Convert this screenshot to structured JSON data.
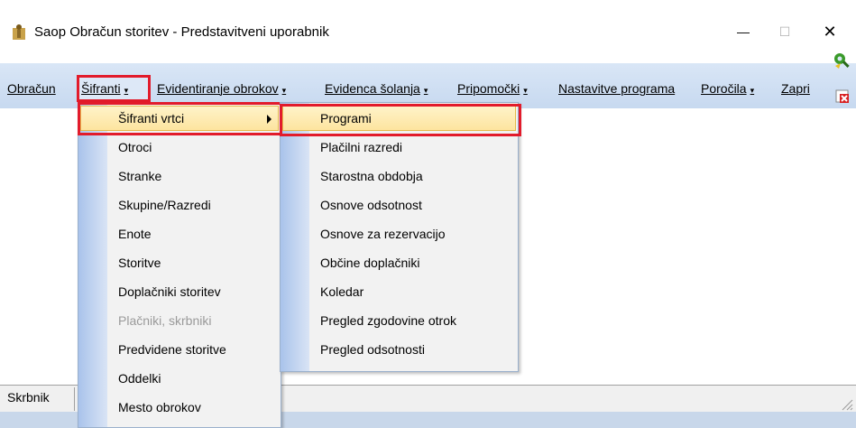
{
  "window": {
    "title": "Saop Obračun storitev - Predstavitveni uporabnik",
    "minimize_glyph": "—",
    "maximize_glyph": "☐",
    "close_glyph": "✕"
  },
  "menubar": [
    {
      "id": "obracun",
      "label": "Obračun",
      "has_arrow": false
    },
    {
      "id": "sifranti",
      "label": "Šifranti",
      "has_arrow": true
    },
    {
      "id": "evidentiranje",
      "label": "Evidentiranje obrokov",
      "has_arrow": true
    },
    {
      "id": "evidenca",
      "label": "Evidenca šolanja",
      "has_arrow": true
    },
    {
      "id": "pripomocki",
      "label": "Pripomočki",
      "has_arrow": true
    },
    {
      "id": "nastavitve",
      "label": "Nastavitve programa",
      "has_arrow": false
    },
    {
      "id": "porocila",
      "label": "Poročila",
      "has_arrow": true
    },
    {
      "id": "zapri",
      "label": "Zapri",
      "has_arrow": false
    }
  ],
  "arrow_glyph": "▾",
  "sifranti_menu": [
    {
      "label": "Šifranti vrtci",
      "has_submenu": true,
      "highlighted": true,
      "disabled": false
    },
    {
      "label": "Otroci",
      "has_submenu": false,
      "highlighted": false,
      "disabled": false
    },
    {
      "label": "Stranke",
      "has_submenu": false,
      "highlighted": false,
      "disabled": false
    },
    {
      "label": "Skupine/Razredi",
      "has_submenu": false,
      "highlighted": false,
      "disabled": false
    },
    {
      "label": "Enote",
      "has_submenu": false,
      "highlighted": false,
      "disabled": false
    },
    {
      "label": "Storitve",
      "has_submenu": false,
      "highlighted": false,
      "disabled": false
    },
    {
      "label": "Doplačniki storitev",
      "has_submenu": false,
      "highlighted": false,
      "disabled": false
    },
    {
      "label": "Plačniki, skrbniki",
      "has_submenu": false,
      "highlighted": false,
      "disabled": true
    },
    {
      "label": "Predvidene storitve",
      "has_submenu": false,
      "highlighted": false,
      "disabled": false
    },
    {
      "label": "Oddelki",
      "has_submenu": false,
      "highlighted": false,
      "disabled": false
    },
    {
      "label": "Mesto obrokov",
      "has_submenu": false,
      "highlighted": false,
      "disabled": false
    }
  ],
  "vrtci_submenu": [
    {
      "label": "Programi",
      "highlighted": true
    },
    {
      "label": "Plačilni razredi",
      "highlighted": false
    },
    {
      "label": "Starostna obdobja",
      "highlighted": false
    },
    {
      "label": "Osnove odsotnost",
      "highlighted": false
    },
    {
      "label": "Osnove za rezervacijo",
      "highlighted": false
    },
    {
      "label": "Občine doplačniki",
      "highlighted": false
    },
    {
      "label": "Koledar",
      "highlighted": false
    },
    {
      "label": "Pregled zgodovine otrok",
      "highlighted": false
    },
    {
      "label": "Pregled odsotnosti",
      "highlighted": false
    }
  ],
  "statusbar": {
    "text": "Skrbnik"
  },
  "colors": {
    "highlight_border": "#e21b2b",
    "menu_hover_fill": "#fde49f",
    "band": "#c7d9f0"
  },
  "icons": {
    "app": "app-figure-icon",
    "toolbar_1": "green-key-icon",
    "toolbar_2": "close-form-icon"
  }
}
